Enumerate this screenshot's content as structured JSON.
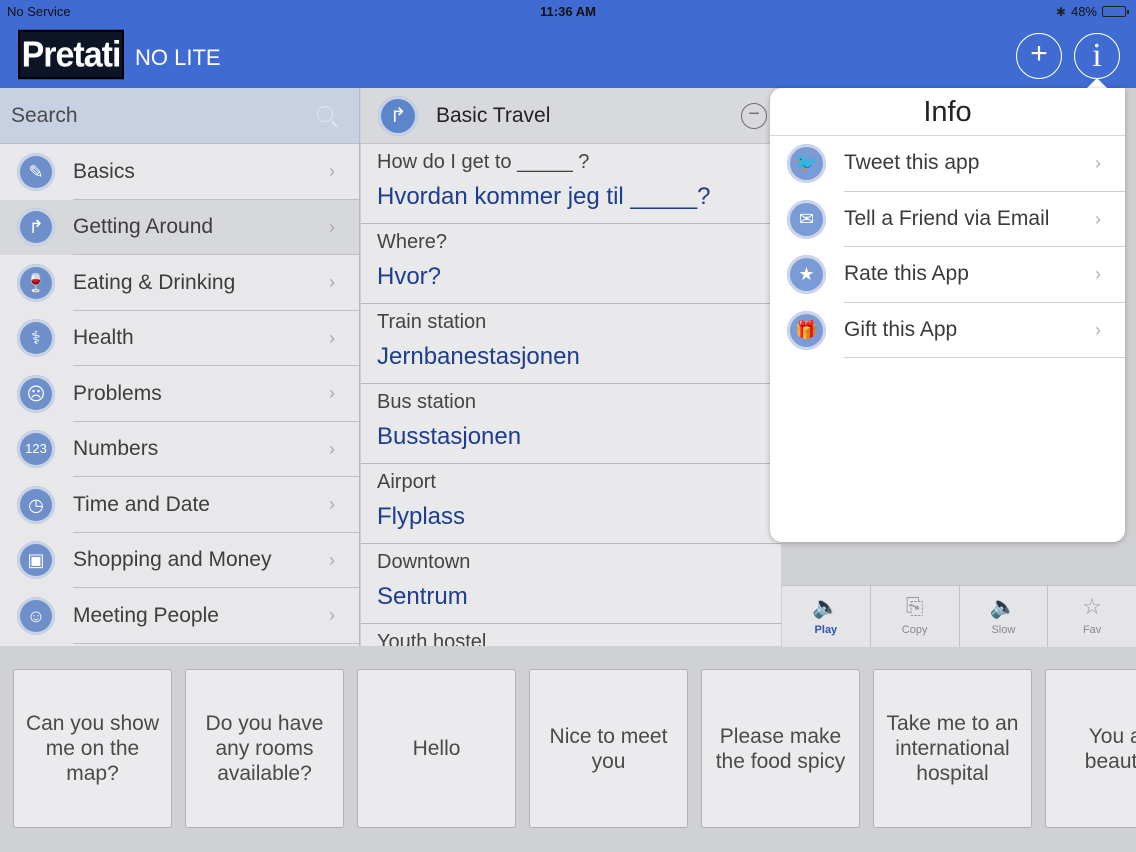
{
  "status": {
    "carrier": "No Service",
    "time": "11:36 AM",
    "battery": "48%",
    "battery_level": 0.48
  },
  "header": {
    "logo": "Pretati",
    "edition": "NO LITE",
    "add_icon": "plus-icon",
    "info_icon": "info-icon"
  },
  "search": {
    "placeholder": "Search"
  },
  "categories": [
    {
      "label": "Basics",
      "icon": "pencil-icon",
      "glyph": "✎"
    },
    {
      "label": "Getting Around",
      "icon": "turn-arrow-icon",
      "glyph": "↱",
      "active": true
    },
    {
      "label": "Eating & Drinking",
      "icon": "glass-icon",
      "glyph": "🍷"
    },
    {
      "label": "Health",
      "icon": "stethoscope-icon",
      "glyph": "⚕"
    },
    {
      "label": "Problems",
      "icon": "sad-face-icon",
      "glyph": "☹"
    },
    {
      "label": "Numbers",
      "icon": "numbers-icon",
      "glyph": "123"
    },
    {
      "label": "Time and Date",
      "icon": "clock-icon",
      "glyph": "◷"
    },
    {
      "label": "Shopping and Money",
      "icon": "shopping-bag-icon",
      "glyph": "▣"
    },
    {
      "label": "Meeting People",
      "icon": "people-icon",
      "glyph": "☺"
    }
  ],
  "phrase_list": {
    "title": "Basic Travel",
    "icon": "turn-arrow-icon",
    "items": [
      {
        "en": "How do I get to _____ ?",
        "no": "Hvordan kommer jeg til _____?"
      },
      {
        "en": "Where?",
        "no": "Hvor?"
      },
      {
        "en": "Train station",
        "no": "Jernbanestasjonen"
      },
      {
        "en": "Bus station",
        "no": "Busstasjonen"
      },
      {
        "en": "Airport",
        "no": "Flyplass"
      },
      {
        "en": "Downtown",
        "no": "Sentrum"
      },
      {
        "en": "Youth hostel",
        "no": ""
      }
    ]
  },
  "toolbar": [
    {
      "label": "Play",
      "icon": "speaker-icon",
      "active": true
    },
    {
      "label": "Copy",
      "icon": "copy-icon"
    },
    {
      "label": "Slow",
      "icon": "speaker-slow-icon"
    },
    {
      "label": "Fav",
      "icon": "star-icon"
    }
  ],
  "info_popover": {
    "title": "Info",
    "items": [
      {
        "label": "Tweet this app",
        "icon": "twitter-icon",
        "glyph": "🐦"
      },
      {
        "label": "Tell a Friend via Email",
        "icon": "envelope-icon",
        "glyph": "✉"
      },
      {
        "label": "Rate this App",
        "icon": "star-icon",
        "glyph": "★"
      },
      {
        "label": "Gift this App",
        "icon": "gift-icon",
        "glyph": "🎁"
      }
    ]
  },
  "favorites": [
    "Can you show me on the map?",
    "Do you have any rooms available?",
    "Hello",
    "Nice to meet you",
    "Please make the food spicy",
    "Take me to an international hospital",
    "You are beautiful"
  ]
}
